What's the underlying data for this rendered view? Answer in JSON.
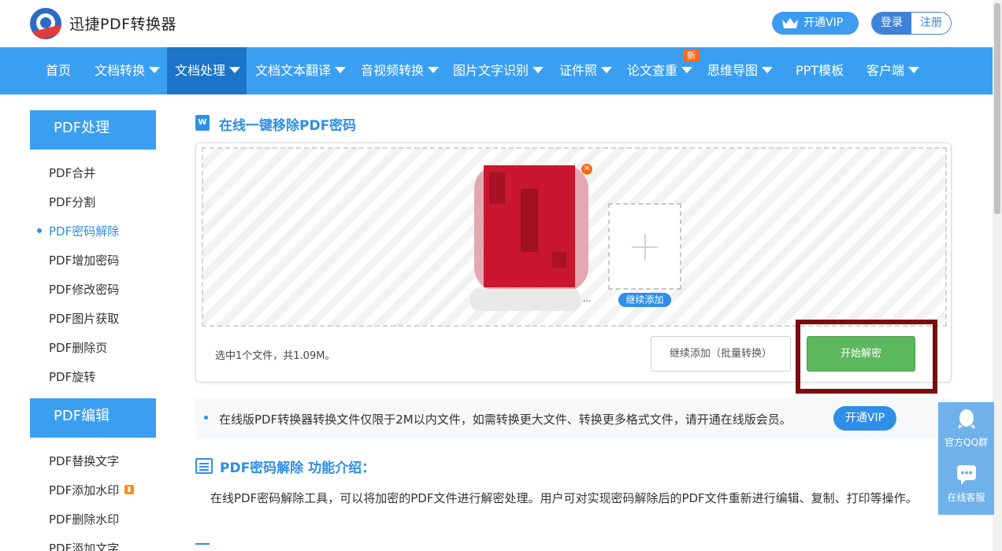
{
  "header": {
    "brand": "迅捷PDF转换器",
    "vip_label": "开通VIP",
    "login_label": "登录",
    "register_label": "注册"
  },
  "nav": {
    "items": [
      {
        "label": "首页",
        "dropdown": false
      },
      {
        "label": "文档转换",
        "dropdown": true
      },
      {
        "label": "文档处理",
        "dropdown": true,
        "active": true
      },
      {
        "label": "文档文本翻译",
        "dropdown": true
      },
      {
        "label": "音视频转换",
        "dropdown": true
      },
      {
        "label": "图片文字识别",
        "dropdown": true
      },
      {
        "label": "证件照",
        "dropdown": true
      },
      {
        "label": "论文查重",
        "dropdown": true
      },
      {
        "label": "思维导图",
        "dropdown": true
      },
      {
        "label": "PPT模板",
        "dropdown": false
      },
      {
        "label": "客户端",
        "dropdown": true
      }
    ],
    "new_badge": "新"
  },
  "sidebar": {
    "sections": [
      {
        "title": "PDF处理",
        "items": [
          "PDF合并",
          "PDF分割",
          "PDF密码解除",
          "PDF增加密码",
          "PDF修改密码",
          "PDF图片获取",
          "PDF删除页",
          "PDF旋转"
        ],
        "active": "PDF密码解除"
      },
      {
        "title": "PDF编辑",
        "items": [
          "PDF替换文字",
          "PDF添加水印",
          "PDF删除水印",
          "PDF添加文字"
        ]
      }
    ]
  },
  "main": {
    "title_icon": "W",
    "title": "在线一键移除PDF密码",
    "upload": {
      "file_name_ellipsis": "...",
      "add_more_label": "继续添加",
      "summary": "选中1个文件，共1.09M。",
      "batch_button": "继续添加（批量转换）",
      "start_button": "开始解密"
    },
    "notice": {
      "text": "在线版PDF转换器转换文件仅限于2M以内文件，如需转换更大文件、转换更多格式文件，请开通在线版会员。",
      "vip_button": "开通VIP"
    },
    "intro": {
      "title": "PDF密码解除 功能介绍：",
      "text": "在线PDF密码解除工具，可以将加密的PDF文件进行解密处理。用户可对实现密码解除后的PDF文件重新进行编辑、复制、打印等操作。"
    }
  },
  "float_service": {
    "qq_label": "官方QQ群",
    "online_label": "在线客服"
  },
  "colors": {
    "primary": "#3b9ff1",
    "nav_active": "#1b74c8",
    "start_button": "#5cb85c",
    "highlight_box": "#7a0c10",
    "new_badge": "#ff6a1a"
  },
  "icons": [
    "logo-icon",
    "crown-icon",
    "caret-down-icon",
    "word-doc-icon",
    "close-icon",
    "plus-icon",
    "news-icon",
    "qq-icon",
    "chat-icon"
  ]
}
